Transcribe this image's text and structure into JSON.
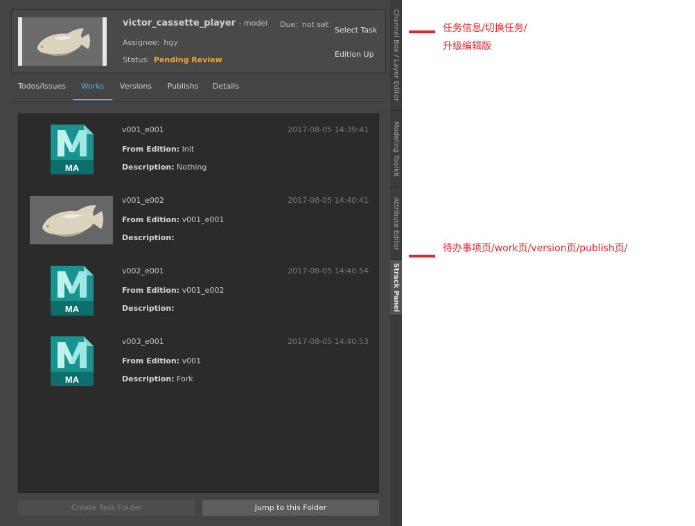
{
  "task": {
    "name": "victor_cassette_player",
    "type_suffix": "- model",
    "assignee_label": "Assignee:",
    "assignee": "hgy",
    "status_label": "Status:",
    "status": "Pending Review",
    "due_label": "Due:",
    "due": "not set",
    "select_task": "Select Task",
    "edition_up": "Edition Up"
  },
  "tabs": [
    {
      "label": "Todos/Issues"
    },
    {
      "label": "Works"
    },
    {
      "label": "Versions"
    },
    {
      "label": "Publishs"
    },
    {
      "label": "Details"
    }
  ],
  "active_tab": "Works",
  "works": [
    {
      "name": "v001_e001",
      "date": "2017-08-05 14:39:41",
      "from_label": "From Edition:",
      "from": "Init",
      "desc_label": "Description:",
      "desc": "Nothing",
      "thumb": "maya-ma-icon"
    },
    {
      "name": "v001_e002",
      "date": "2017-08-05 14:40:41",
      "from_label": "From Edition:",
      "from": "v001_e001",
      "desc_label": "Description:",
      "desc": "",
      "thumb": "fish-render"
    },
    {
      "name": "v002_e001",
      "date": "2017-08-05 14:40:54",
      "from_label": "From Edition:",
      "from": "v001_e002",
      "desc_label": "Description:",
      "desc": "",
      "thumb": "maya-ma-icon"
    },
    {
      "name": "v003_e001",
      "date": "2017-08-05 14:40:53",
      "from_label": "From Edition:",
      "from": "v001",
      "desc_label": "Description:",
      "desc": "Fork",
      "thumb": "maya-ma-icon"
    }
  ],
  "icon_text": "MA",
  "buttons": {
    "create_folder": "Create Task Folder",
    "jump_folder": "Jump to this Folder"
  },
  "side_tabs": [
    {
      "label": "Channel Box / Layer Editor"
    },
    {
      "label": "Modeling Toolkit"
    },
    {
      "label": "Attribute Editor"
    },
    {
      "label": "Strack Panel"
    }
  ],
  "annotations": {
    "task_line1": "任务信息/切换任务/",
    "task_line2": "升级编辑版",
    "pages": "待办事项页/work页/version页/publish页/"
  },
  "colors": {
    "status": "#f0a630",
    "tab_active": "#5ab0e8",
    "annotation": "#e3262c"
  }
}
